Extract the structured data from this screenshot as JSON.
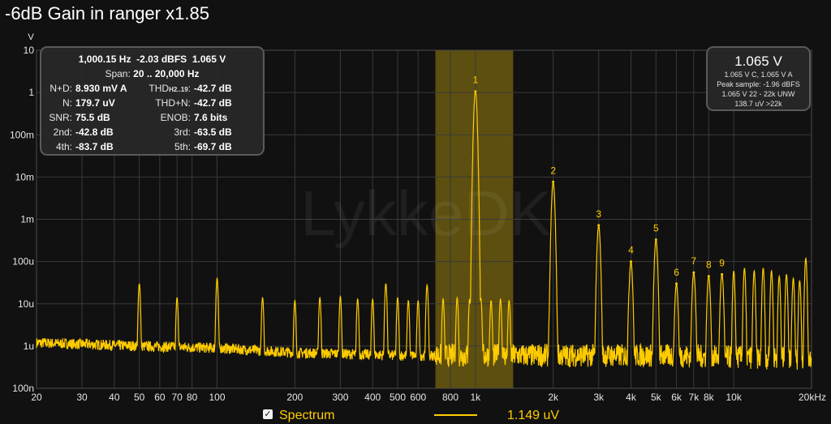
{
  "window": {
    "title": "-6dB Gain in ranger x1.85"
  },
  "stats_panel": {
    "line1": {
      "freq": "1,000.15 Hz",
      "dbfs": "-2.03 dBFS",
      "volts": "1.065 V"
    },
    "span": {
      "label": "Span:",
      "value": "20 .. 20,000 Hz"
    },
    "rows": [
      {
        "l_label": "N+D:",
        "l_value": "8.930 mV A",
        "r_label": "THD",
        "r_sub": "H2..19",
        "r_value": "-42.7 dB"
      },
      {
        "l_label": "N:",
        "l_value": "179.7 uV",
        "r_label": "THD+N:",
        "r_sub": "",
        "r_value": "-42.7 dB"
      },
      {
        "l_label": "SNR:",
        "l_value": "75.5 dB",
        "r_label": "ENOB:",
        "r_sub": "",
        "r_value": "7.6 bits"
      },
      {
        "l_label": "2nd:",
        "l_value": "-42.8 dB",
        "r_label": "3rd:",
        "r_sub": "",
        "r_value": "-63.5 dB"
      },
      {
        "l_label": "4th:",
        "l_value": "-83.7 dB",
        "r_label": "5th:",
        "r_sub": "",
        "r_value": "-69.7 dB"
      }
    ]
  },
  "readout_panel": {
    "main": "1.065 V",
    "lines": [
      "1.065 V C, 1.065 V A",
      "Peak sample: -1.96 dBFS",
      "1.065 V 22 - 22k UNW",
      "138.7 uV >22k"
    ]
  },
  "legend": {
    "checkbox_label": "Spectrum",
    "checked": true,
    "value": "1.149 uV"
  },
  "watermark": "LykkeDK",
  "colors": {
    "trace": "#ffcc00",
    "band": "#6b5a10",
    "grid": "#3a3a3a",
    "background": "#111111"
  },
  "chart_data": {
    "type": "line",
    "title": "-6dB Gain in ranger x1.85",
    "xscale": "log",
    "yscale": "log",
    "xlim": [
      20,
      20000
    ],
    "ylim": [
      1e-07,
      10
    ],
    "ylabel": "V",
    "x_ticks": [
      {
        "v": 20,
        "t": "20"
      },
      {
        "v": 30,
        "t": "30"
      },
      {
        "v": 40,
        "t": "40"
      },
      {
        "v": 50,
        "t": "50"
      },
      {
        "v": 60,
        "t": "60"
      },
      {
        "v": 70,
        "t": "70"
      },
      {
        "v": 80,
        "t": "80"
      },
      {
        "v": 100,
        "t": "100"
      },
      {
        "v": 200,
        "t": "200"
      },
      {
        "v": 300,
        "t": "300"
      },
      {
        "v": 400,
        "t": "400"
      },
      {
        "v": 500,
        "t": "500"
      },
      {
        "v": 600,
        "t": "600"
      },
      {
        "v": 800,
        "t": "800"
      },
      {
        "v": 1000,
        "t": "1k"
      },
      {
        "v": 2000,
        "t": "2k"
      },
      {
        "v": 3000,
        "t": "3k"
      },
      {
        "v": 4000,
        "t": "4k"
      },
      {
        "v": 5000,
        "t": "5k"
      },
      {
        "v": 6000,
        "t": "6k"
      },
      {
        "v": 7000,
        "t": "7k"
      },
      {
        "v": 8000,
        "t": "8k"
      },
      {
        "v": 10000,
        "t": "10k"
      },
      {
        "v": 20000,
        "t": "20kHz"
      }
    ],
    "y_ticks": [
      {
        "v": 10,
        "t": "10"
      },
      {
        "v": 1,
        "t": "1"
      },
      {
        "v": 0.1,
        "t": "100m"
      },
      {
        "v": 0.01,
        "t": "10m"
      },
      {
        "v": 0.001,
        "t": "1m"
      },
      {
        "v": 0.0001,
        "t": "100u"
      },
      {
        "v": 1e-05,
        "t": "10u"
      },
      {
        "v": 1e-06,
        "t": "1u"
      },
      {
        "v": 1e-07,
        "t": "100n"
      }
    ],
    "highlight_band": [
      700,
      1400
    ],
    "harmonics": [
      {
        "n": "1",
        "f": 1000,
        "v": 1.065
      },
      {
        "n": "2",
        "f": 2000,
        "v": 0.0077
      },
      {
        "n": "3",
        "f": 3000,
        "v": 0.00072
      },
      {
        "n": "4",
        "f": 4000,
        "v": 0.0001
      },
      {
        "n": "5",
        "f": 5000,
        "v": 0.00033
      },
      {
        "n": "6",
        "f": 6000,
        "v": 3e-05
      },
      {
        "n": "7",
        "f": 7000,
        "v": 5.5e-05
      },
      {
        "n": "8",
        "f": 8000,
        "v": 4.5e-05
      },
      {
        "n": "9",
        "f": 9000,
        "v": 5e-05
      }
    ],
    "spurs": [
      {
        "f": 50,
        "v": 3e-05
      },
      {
        "f": 70,
        "v": 1.4e-05
      },
      {
        "f": 100,
        "v": 4e-05
      },
      {
        "f": 150,
        "v": 1.4e-05
      },
      {
        "f": 200,
        "v": 1.2e-05
      },
      {
        "f": 250,
        "v": 1.4e-05
      },
      {
        "f": 300,
        "v": 1.5e-05
      },
      {
        "f": 350,
        "v": 1.3e-05
      },
      {
        "f": 400,
        "v": 1.3e-05
      },
      {
        "f": 450,
        "v": 3e-05
      },
      {
        "f": 500,
        "v": 1.4e-05
      },
      {
        "f": 550,
        "v": 1.2e-05
      },
      {
        "f": 600,
        "v": 1.2e-05
      },
      {
        "f": 650,
        "v": 2.8e-05
      },
      {
        "f": 750,
        "v": 1.3e-05
      },
      {
        "f": 850,
        "v": 1.4e-05
      },
      {
        "f": 950,
        "v": 1.3e-05
      },
      {
        "f": 1050,
        "v": 1.3e-05
      },
      {
        "f": 1150,
        "v": 1.2e-05
      },
      {
        "f": 1250,
        "v": 1.3e-05
      },
      {
        "f": 1350,
        "v": 1.2e-05
      },
      {
        "f": 1950,
        "v": 2e-05
      },
      {
        "f": 2050,
        "v": 1.5e-05
      },
      {
        "f": 2950,
        "v": 1.5e-05
      },
      {
        "f": 3950,
        "v": 2.5e-05
      },
      {
        "f": 5950,
        "v": 1.2e-05
      },
      {
        "f": 10000,
        "v": 6e-05
      },
      {
        "f": 11000,
        "v": 7e-05
      },
      {
        "f": 12000,
        "v": 6e-05
      },
      {
        "f": 13000,
        "v": 7e-05
      },
      {
        "f": 14000,
        "v": 6e-05
      },
      {
        "f": 15000,
        "v": 4.5e-05
      },
      {
        "f": 16000,
        "v": 5e-05
      },
      {
        "f": 17000,
        "v": 4e-05
      },
      {
        "f": 18000,
        "v": 3.5e-05
      },
      {
        "f": 19000,
        "v": 0.00012
      }
    ],
    "noise_floor": [
      {
        "f": 20,
        "v": 1.2e-06
      },
      {
        "f": 50,
        "v": 1e-06
      },
      {
        "f": 100,
        "v": 9e-07
      },
      {
        "f": 200,
        "v": 7e-07
      },
      {
        "f": 500,
        "v": 6e-07
      },
      {
        "f": 1000,
        "v": 6e-07
      },
      {
        "f": 2000,
        "v": 6e-07
      },
      {
        "f": 5000,
        "v": 6e-07
      },
      {
        "f": 10000,
        "v": 5.5e-07
      },
      {
        "f": 20000,
        "v": 5e-07
      }
    ]
  }
}
